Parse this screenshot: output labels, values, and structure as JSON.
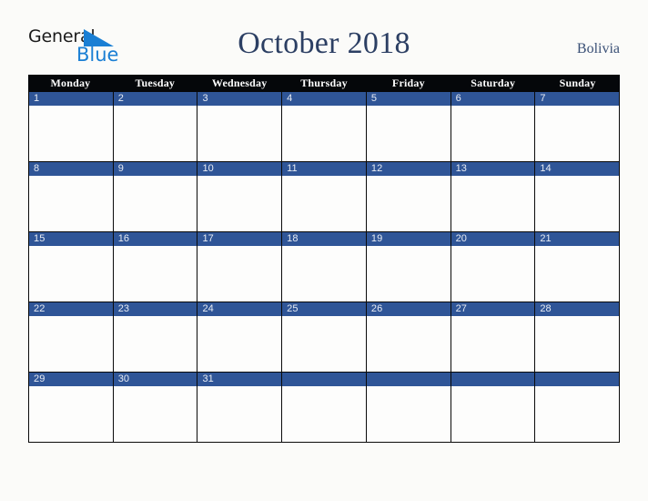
{
  "brand": {
    "name_part1": "General",
    "name_part2": "Blue",
    "triangle_icon": "triangle-icon",
    "accent_color": "#1a7fd4",
    "text_color": "#1b1b1b"
  },
  "header": {
    "title": "October 2018",
    "country": "Bolivia",
    "title_color": "#2c3f63",
    "country_color": "#3a5076"
  },
  "calendar": {
    "month": "October",
    "year": "2018",
    "header_bg": "#05070a",
    "day_bar_color": "#2f5597",
    "day_number_color": "#e8ecf4",
    "cell_bg": "#fdfdfc",
    "border_color": "#0a0a0a",
    "weekdays": [
      "Monday",
      "Tuesday",
      "Wednesday",
      "Thursday",
      "Friday",
      "Saturday",
      "Sunday"
    ],
    "weeks": [
      [
        {
          "day": "1"
        },
        {
          "day": "2"
        },
        {
          "day": "3"
        },
        {
          "day": "4"
        },
        {
          "day": "5"
        },
        {
          "day": "6"
        },
        {
          "day": "7"
        }
      ],
      [
        {
          "day": "8"
        },
        {
          "day": "9"
        },
        {
          "day": "10"
        },
        {
          "day": "11"
        },
        {
          "day": "12"
        },
        {
          "day": "13"
        },
        {
          "day": "14"
        }
      ],
      [
        {
          "day": "15"
        },
        {
          "day": "16"
        },
        {
          "day": "17"
        },
        {
          "day": "18"
        },
        {
          "day": "19"
        },
        {
          "day": "20"
        },
        {
          "day": "21"
        }
      ],
      [
        {
          "day": "22"
        },
        {
          "day": "23"
        },
        {
          "day": "24"
        },
        {
          "day": "25"
        },
        {
          "day": "26"
        },
        {
          "day": "27"
        },
        {
          "day": "28"
        }
      ],
      [
        {
          "day": "29"
        },
        {
          "day": "30"
        },
        {
          "day": "31"
        },
        {
          "day": ""
        },
        {
          "day": ""
        },
        {
          "day": ""
        },
        {
          "day": ""
        }
      ]
    ]
  },
  "page": {
    "background": "#fbfbf9"
  }
}
